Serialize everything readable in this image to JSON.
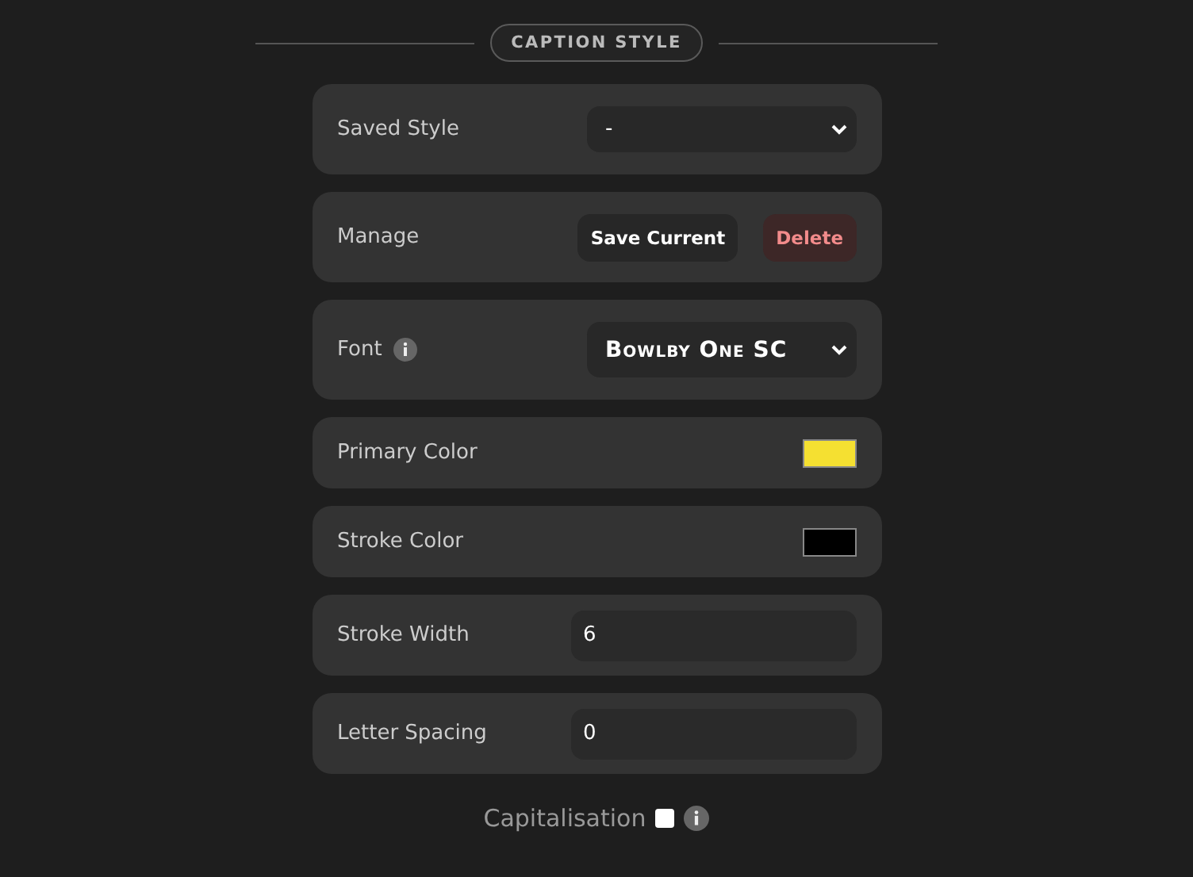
{
  "section_title": "CAPTION STYLE",
  "rows": [
    {
      "kind": "select",
      "label": "Saved Style",
      "value": "-"
    },
    {
      "kind": "buttons",
      "label": "Manage",
      "buttons": [
        {
          "label": "Save Current",
          "danger": false
        },
        {
          "label": "Delete",
          "danger": true
        }
      ]
    },
    {
      "kind": "select",
      "label": "Font",
      "info": true,
      "value": "Bowlby One SC",
      "font_preview": true
    },
    {
      "kind": "color",
      "label": "Primary Color",
      "color": "#f5e031"
    },
    {
      "kind": "color",
      "label": "Stroke Color",
      "color": "#000000"
    },
    {
      "kind": "number",
      "label": "Stroke Width",
      "value": "6"
    },
    {
      "kind": "number",
      "label": "Letter Spacing",
      "value": "0"
    }
  ],
  "capitalisation": {
    "label": "Capitalisation",
    "checked": false,
    "info": true
  }
}
